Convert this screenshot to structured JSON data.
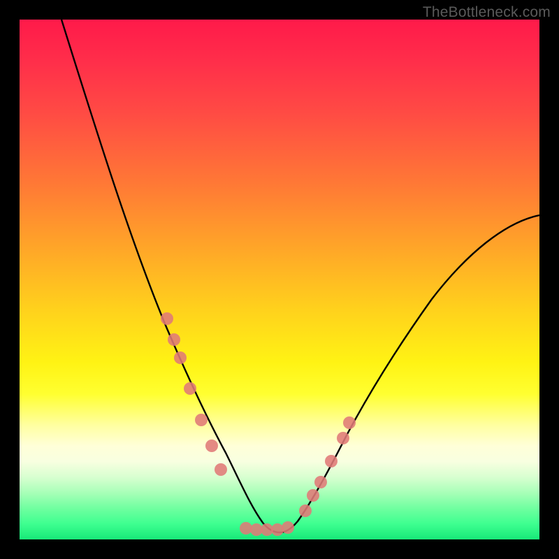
{
  "watermark": "TheBottleneck.com",
  "chart_data": {
    "type": "line",
    "title": "",
    "xlabel": "",
    "ylabel": "",
    "xlim": [
      0,
      100
    ],
    "ylim": [
      0,
      100
    ],
    "grid": false,
    "legend": false,
    "note": "Axes are unlabeled; values are estimated percentages (0 at bottom/left, 100 at top/right) read from pixel positions.",
    "series": [
      {
        "name": "bottleneck-curve",
        "x": [
          8,
          12,
          16,
          20,
          24,
          28,
          31,
          33,
          35,
          37,
          39,
          41,
          43,
          45,
          47,
          49,
          51,
          53,
          56,
          59,
          62,
          66,
          70,
          75,
          80,
          86,
          92,
          100
        ],
        "y": [
          100,
          90,
          79,
          68,
          57,
          45,
          37,
          31,
          26,
          21,
          16,
          12,
          8,
          5,
          3,
          2,
          2,
          3,
          5,
          9,
          14,
          20,
          26,
          33,
          40,
          47,
          54,
          62
        ]
      }
    ],
    "markers": [
      {
        "name": "left-branch-dots",
        "x": [
          28.5,
          29.8,
          31.0,
          32.8,
          35.0,
          37.0,
          38.8
        ],
        "y": [
          42.5,
          38.5,
          35.0,
          29.0,
          23.0,
          18.0,
          13.5
        ]
      },
      {
        "name": "right-branch-dots",
        "x": [
          55.0,
          56.5,
          58.0,
          60.0,
          62.2,
          63.5
        ],
        "y": [
          5.5,
          8.5,
          11.0,
          15.0,
          19.5,
          22.5
        ]
      },
      {
        "name": "trough-dots",
        "x": [
          43.5,
          45.5,
          47.5,
          49.5,
          51.5
        ],
        "y": [
          2.2,
          2.0,
          2.0,
          2.0,
          2.4
        ]
      }
    ],
    "background_gradient": {
      "top_color": "#ff1a4a",
      "mid_color": "#ffd21c",
      "bottom_color": "#18e878"
    }
  }
}
